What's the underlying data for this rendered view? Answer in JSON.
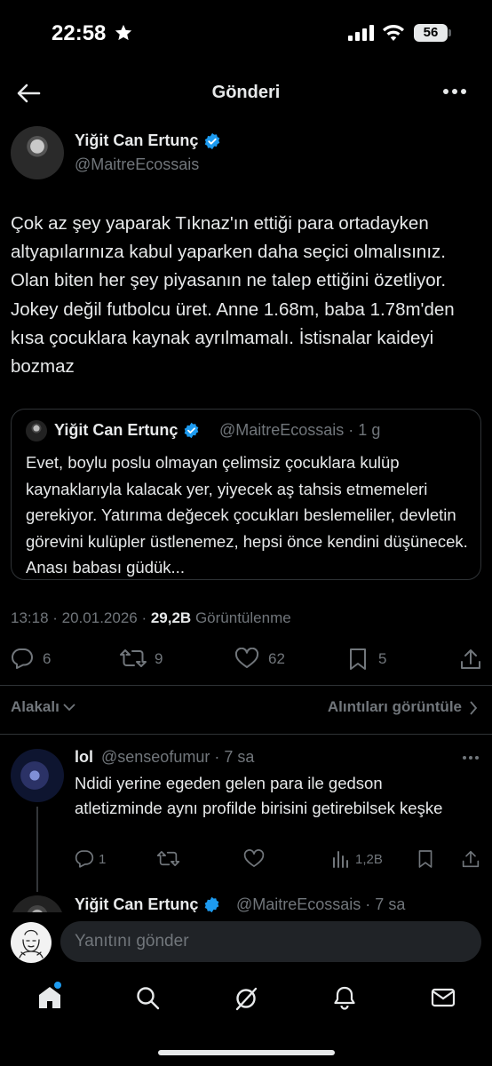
{
  "status_bar": {
    "time": "22:58",
    "battery": "56"
  },
  "header": {
    "title": "Gönderi"
  },
  "post": {
    "author_name": "Yiğit Can Ertunç",
    "author_handle": "@MaitreEcossais",
    "text": "Çok az şey yaparak Tıknaz'ın ettiği para ortadayken altyapılarınıza kabul yaparken daha seçici olmalısınız. Olan biten her şey piyasanın ne talep ettiğini özetliyor. Jokey değil futbolcu üret. Anne 1.68m, baba 1.78m'den kısa çocuklara kaynak ayrılmamalı. İstisnalar kaideyi bozmaz",
    "quote": {
      "author_name": "Yiğit Can Ertunç",
      "handle_time": "@MaitreEcossais · 1 g",
      "text": "Evet, boylu poslu olmayan çelimsiz çocuklara kulüp kaynaklarıyla kalacak yer, yiyecek aş tahsis etmemeleri gerekiyor. Yatırıma değecek çocukları beslemeliler, devletin görevini kulüpler üstlenemez, hepsi önce kendini düşünecek. Anası babası güdük..."
    },
    "timestamp": "13:18 · 20.01.2026 · ",
    "views_count": "29,2B",
    "views_label": "Görüntülenme",
    "counts": {
      "replies": "6",
      "reposts": "9",
      "likes": "62",
      "bookmarks": "5"
    }
  },
  "sort": {
    "label": "Alakalı",
    "quotes_link": "Alıntıları görüntüle"
  },
  "replies": [
    {
      "author_name": "lol",
      "handle_time": "@senseofumur · 7 sa",
      "text": "Ndidi yerine egeden gelen para ile gedson atletizminde aynı profilde birisini getirebilsek keşke",
      "counts": {
        "replies": "1",
        "views": "1,2B"
      }
    },
    {
      "author_name": "Yiğit Can Ertunç",
      "handle_time": "@MaitreEcossais · 7 sa"
    }
  ],
  "compose": {
    "placeholder": "Yanıtını gönder"
  },
  "colors": {
    "background": "#000000",
    "text": "#e7e9ea",
    "muted": "#71767b",
    "accent": "#1d9bf0",
    "border": "#2f3336"
  }
}
